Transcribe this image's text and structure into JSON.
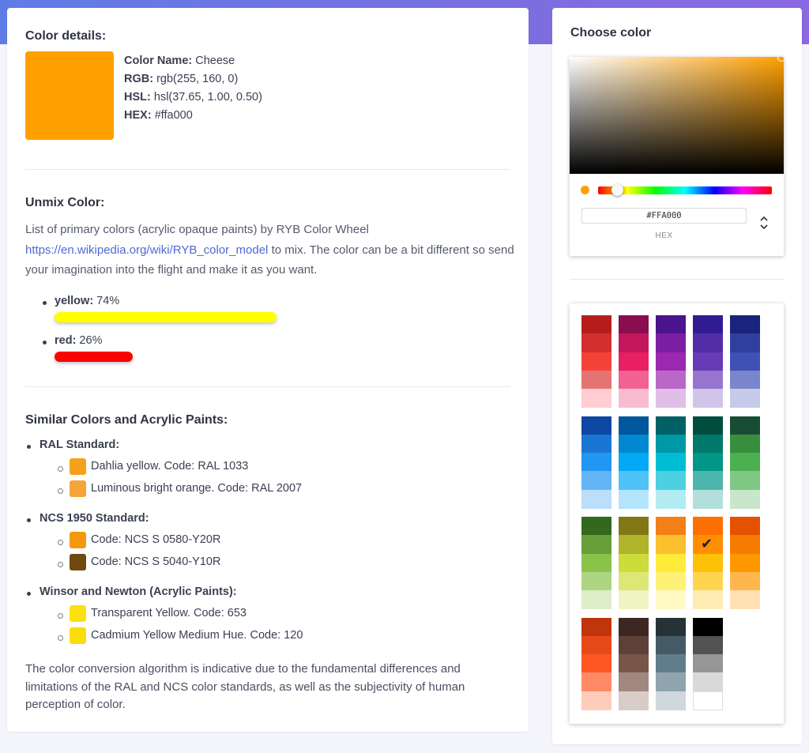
{
  "details": {
    "heading": "Color details:",
    "swatch_color": "#ffa000",
    "name_label": "Color Name:",
    "name_value": "Cheese",
    "rgb_label": "RGB:",
    "rgb_value": "rgb(255, 160, 0)",
    "hsl_label": "HSL:",
    "hsl_value": "hsl(37.65, 1.00, 0.50)",
    "hex_label": "HEX:",
    "hex_value": "#ffa000"
  },
  "unmix": {
    "heading": "Unmix Color:",
    "desc_before": "List of primary colors (acrylic opaque paints) by RYB Color Wheel",
    "link_text": "https://en.wikipedia.org/wiki/RYB_color_model",
    "desc_after": "to mix. The color can be a bit different so send your imagination into the flight and make it as you want.",
    "items": [
      {
        "name": "yellow:",
        "percent": "74%",
        "fraction": 0.74,
        "color": "#ffff00"
      },
      {
        "name": "red:",
        "percent": "26%",
        "fraction": 0.26,
        "color": "#ff0000"
      }
    ]
  },
  "similar": {
    "heading": "Similar Colors and Acrylic Paints:",
    "groups": [
      {
        "title": "RAL Standard:",
        "items": [
          {
            "label": "Dahlia yellow. Code: RAL 1033",
            "color": "#f4a21a"
          },
          {
            "label": "Luminous bright orange. Code: RAL 2007",
            "color": "#f5a43a"
          }
        ]
      },
      {
        "title": "NCS 1950 Standard:",
        "items": [
          {
            "label": "Code: NCS S 0580-Y20R",
            "color": "#f4990e"
          },
          {
            "label": "Code: NCS S 5040-Y10R",
            "color": "#6e4a10"
          }
        ]
      },
      {
        "title": "Winsor and Newton (Acrylic Paints):",
        "items": [
          {
            "label": "Transparent Yellow. Code: 653",
            "color": "#fbe10e"
          },
          {
            "label": "Cadmium Yellow Medium Hue. Code: 120",
            "color": "#fbdc0c"
          }
        ]
      }
    ]
  },
  "footer": "The color conversion algorithm is indicative due to the fundamental differences and limitations of the RAL and NCS color standards, as well as the subjectivity of human perception of color.",
  "picker": {
    "heading": "Choose color",
    "hex_input": "#FFA000",
    "hex_mode": "HEX",
    "current_color": "#ffa000"
  },
  "palette": {
    "selected": "#ff8f00",
    "groups": [
      [
        [
          "#b71c1c",
          "#d32f2f",
          "#f44336",
          "#e57373",
          "#ffcdd2"
        ],
        [
          "#880e4f",
          "#c2185b",
          "#e91e63",
          "#f06292",
          "#f8bbd0"
        ],
        [
          "#4a148c",
          "#7b1fa2",
          "#9c27b0",
          "#ba68c8",
          "#e1bee7"
        ],
        [
          "#311b92",
          "#512da8",
          "#673ab7",
          "#9575cd",
          "#d1c4e9"
        ],
        [
          "#1a237e",
          "#303f9f",
          "#3f51b5",
          "#7986cb",
          "#c5cae9"
        ]
      ],
      [
        [
          "#0d47a1",
          "#1976d2",
          "#2196f3",
          "#64b5f6",
          "#bbdefb"
        ],
        [
          "#01579b",
          "#0288d1",
          "#03a9f4",
          "#4fc3f7",
          "#b3e5fc"
        ],
        [
          "#006064",
          "#0097a7",
          "#00bcd4",
          "#4dd0e1",
          "#b2ebf2"
        ],
        [
          "#004d40",
          "#00796b",
          "#009688",
          "#4db6ac",
          "#b2dfdb"
        ],
        [
          "#194d33",
          "#388e3c",
          "#4caf50",
          "#81c784",
          "#c8e6c9"
        ]
      ],
      [
        [
          "#33691e",
          "#689f38",
          "#8bc34a",
          "#aed581",
          "#dcedc8"
        ],
        [
          "#827717",
          "#afb42b",
          "#cddc39",
          "#dce775",
          "#f0f4c3"
        ],
        [
          "#f57f17",
          "#fbc02d",
          "#ffeb3b",
          "#fff176",
          "#fff9c4"
        ],
        [
          "#ff6f00",
          "#ff8f00",
          "#ffc107",
          "#ffd54f",
          "#ffecb3"
        ],
        [
          "#e65100",
          "#f57c00",
          "#ff9800",
          "#ffb74d",
          "#ffe0b2"
        ]
      ],
      [
        [
          "#bf360c",
          "#e64a19",
          "#ff5722",
          "#ff8a65",
          "#ffccbc"
        ],
        [
          "#3e2723",
          "#5d4037",
          "#795548",
          "#a1887f",
          "#d7ccc8"
        ],
        [
          "#263238",
          "#455a64",
          "#607d8b",
          "#90a4ae",
          "#cfd8dc"
        ],
        [
          "#000000",
          "#525252",
          "#969696",
          "#d9d9d9",
          "#ffffff"
        ]
      ]
    ]
  }
}
